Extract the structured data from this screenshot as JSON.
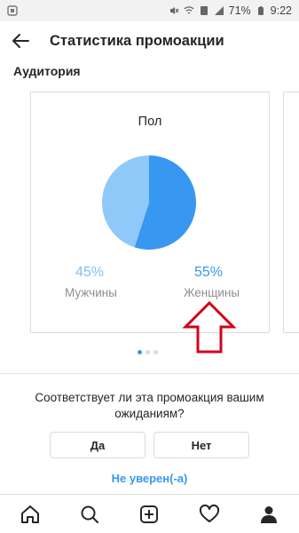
{
  "status_bar": {
    "battery_percent": "71%",
    "time": "9:22",
    "icons": [
      "notification-icon",
      "mute-icon",
      "wifi-icon",
      "sim-icon",
      "signal-icon",
      "battery-icon"
    ]
  },
  "header": {
    "title": "Статистика промоакции",
    "back_icon": "back-arrow-icon"
  },
  "section": {
    "title": "Аудитория"
  },
  "gender_card": {
    "title": "Пол",
    "chart_data": {
      "type": "pie",
      "title": "Пол",
      "slices": [
        {
          "label": "Мужчины",
          "value": 45,
          "display": "45%",
          "color": "#8ec9fa"
        },
        {
          "label": "Женщины",
          "value": 55,
          "display": "55%",
          "color": "#3897f0"
        }
      ]
    }
  },
  "pager": {
    "total": 3,
    "active": 0
  },
  "feedback": {
    "question": "Соответствует ли эта промоакция вашим ожиданиям?",
    "yes_label": "Да",
    "no_label": "Нет",
    "unsure_label": "Не уверен(-а)"
  },
  "bottom_nav": {
    "items": [
      "home-icon",
      "search-icon",
      "add-icon",
      "heart-icon",
      "profile-icon"
    ]
  },
  "colors": {
    "accent": "#3897f0",
    "light_accent": "#8ec9fa",
    "annotation_arrow": "#d0021b"
  }
}
